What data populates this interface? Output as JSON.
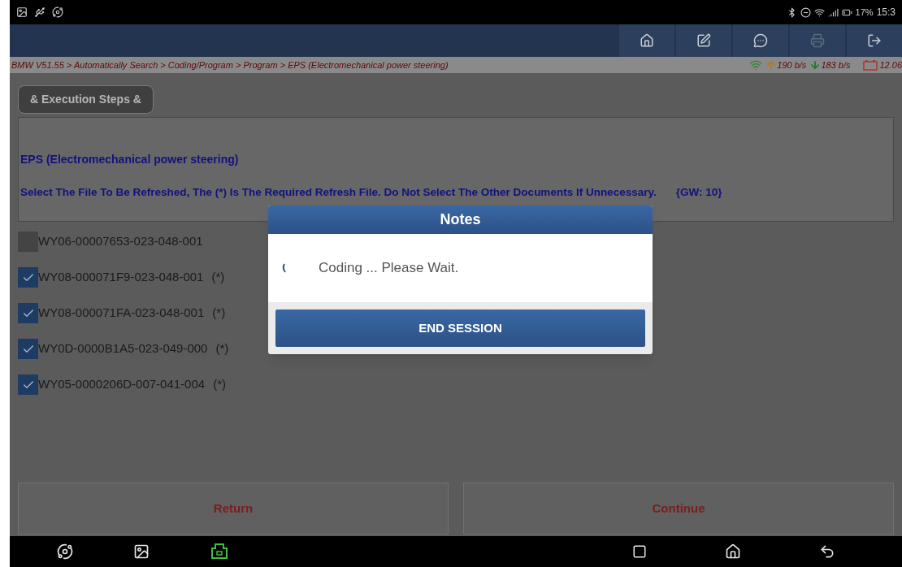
{
  "status_bar": {
    "battery": "17%",
    "time": "15:3"
  },
  "toolbar": [
    {
      "kind": "home",
      "disabled": false
    },
    {
      "kind": "edit",
      "disabled": false
    },
    {
      "kind": "chat",
      "disabled": false
    },
    {
      "kind": "print",
      "disabled": true
    },
    {
      "kind": "exit",
      "disabled": false
    }
  ],
  "breadcrumb": "BMW V51.55 > Automatically Search > Coding/Program > Program > EPS (Electromechanical power steering)",
  "link_stats": {
    "upload": "190 b/s",
    "download": "183 b/s",
    "voltage": "12.06"
  },
  "steps_button": "& Execution Steps &",
  "info": {
    "title": "EPS (Electromechanical power steering)",
    "instruction": "Select The File To Be Refreshed, The (*) Is The Required Refresh File. Do Not Select The Other Documents If Unnecessary.",
    "gateway": "{GW: 10}"
  },
  "files": [
    {
      "name": "WY06-00007653-023-048-001",
      "checked": false
    },
    {
      "name": "WY08-000071F9-023-048-001",
      "suffix": "(*)",
      "checked": true
    },
    {
      "name": "WY08-000071FA-023-048-001",
      "suffix": "(*)",
      "checked": true
    },
    {
      "name": "WY0D-0000B1A5-023-049-000",
      "suffix": "(*)",
      "checked": true
    },
    {
      "name": "WY05-0000206D-007-041-004",
      "suffix": "(*)",
      "checked": true
    }
  ],
  "dialog": {
    "title": "Notes",
    "message": "Coding ... Please Wait.",
    "button": "END SESSION"
  },
  "footer_buttons": [
    "Return",
    "Continue"
  ]
}
